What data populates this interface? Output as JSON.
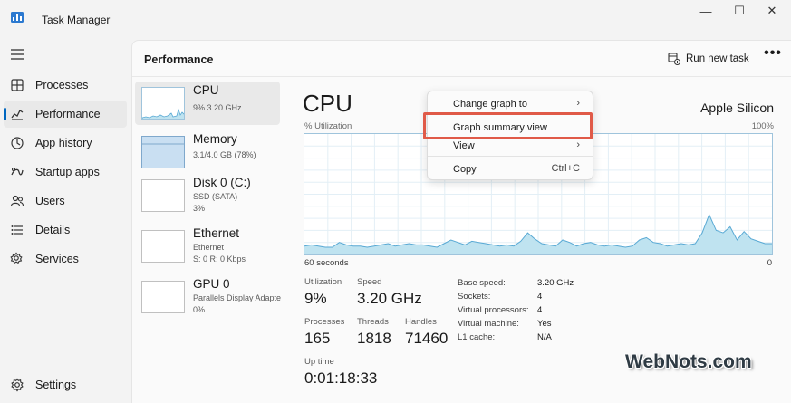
{
  "window": {
    "title": "Task Manager",
    "minimize_glyph": "—",
    "maximize_glyph": "☐",
    "close_glyph": "✕"
  },
  "nav": {
    "items": [
      {
        "label": "Processes",
        "icon": "processes-icon"
      },
      {
        "label": "Performance",
        "icon": "performance-icon",
        "active": true
      },
      {
        "label": "App history",
        "icon": "app-history-icon"
      },
      {
        "label": "Startup apps",
        "icon": "startup-apps-icon"
      },
      {
        "label": "Users",
        "icon": "users-icon"
      },
      {
        "label": "Details",
        "icon": "details-icon"
      },
      {
        "label": "Services",
        "icon": "services-icon"
      }
    ],
    "settings": "Settings"
  },
  "header": {
    "title": "Performance",
    "run_new_task": "Run new task",
    "more": "•••"
  },
  "resources": [
    {
      "name": "CPU",
      "sub1": "9% 3.20 GHz",
      "sub2": ""
    },
    {
      "name": "Memory",
      "sub1": "3.1/4.0 GB (78%)",
      "sub2": ""
    },
    {
      "name": "Disk 0 (C:)",
      "sub1": "SSD (SATA)",
      "sub2": "3%"
    },
    {
      "name": "Ethernet",
      "sub1": "Ethernet",
      "sub2": "S: 0 R: 0 Kbps"
    },
    {
      "name": "GPU 0",
      "sub1": "Parallels Display Adapte",
      "sub2": "0%"
    }
  ],
  "cpu": {
    "title": "CPU",
    "model": "Apple Silicon",
    "utilization_label": "% Utilization",
    "max_label": "100%",
    "time_label": "60 seconds",
    "zero_label": "0",
    "graph_fill_color": "#bfe3f0",
    "graph_line_color": "#58a9d4",
    "history": [
      7,
      8,
      7,
      6,
      6,
      10,
      8,
      7,
      7,
      6,
      7,
      8,
      9,
      7,
      8,
      9,
      8,
      8,
      7,
      6,
      9,
      12,
      10,
      8,
      11,
      10,
      9,
      8,
      7,
      8,
      7,
      11,
      18,
      13,
      9,
      8,
      7,
      12,
      10,
      7,
      9,
      10,
      8,
      7,
      8,
      7,
      6,
      7,
      12,
      14,
      10,
      9,
      7,
      8,
      9,
      8,
      9,
      18,
      33,
      20,
      18,
      23,
      12,
      19,
      13,
      11,
      9,
      9
    ],
    "stats": {
      "utilization": {
        "label": "Utilization",
        "value": "9%"
      },
      "speed": {
        "label": "Speed",
        "value": "3.20 GHz"
      },
      "processes": {
        "label": "Processes",
        "value": "165"
      },
      "threads": {
        "label": "Threads",
        "value": "1818"
      },
      "handles": {
        "label": "Handles",
        "value": "71460"
      },
      "uptime": {
        "label": "Up time",
        "value": "0:01:18:33"
      }
    },
    "specs": [
      {
        "label": "Base speed:",
        "value": "3.20 GHz"
      },
      {
        "label": "Sockets:",
        "value": "4"
      },
      {
        "label": "Virtual processors:",
        "value": "4"
      },
      {
        "label": "Virtual machine:",
        "value": "Yes"
      },
      {
        "label": "L1 cache:",
        "value": "N/A"
      }
    ]
  },
  "context_menu": {
    "items": [
      {
        "label": "Change graph to",
        "right": "›"
      },
      {
        "label": "Graph summary view",
        "right": ""
      },
      {
        "label": "View",
        "right": "›"
      },
      {
        "label": "Copy",
        "right": "Ctrl+C"
      }
    ],
    "highlight_color": "#e05a48"
  },
  "watermark": "WebNots.com"
}
